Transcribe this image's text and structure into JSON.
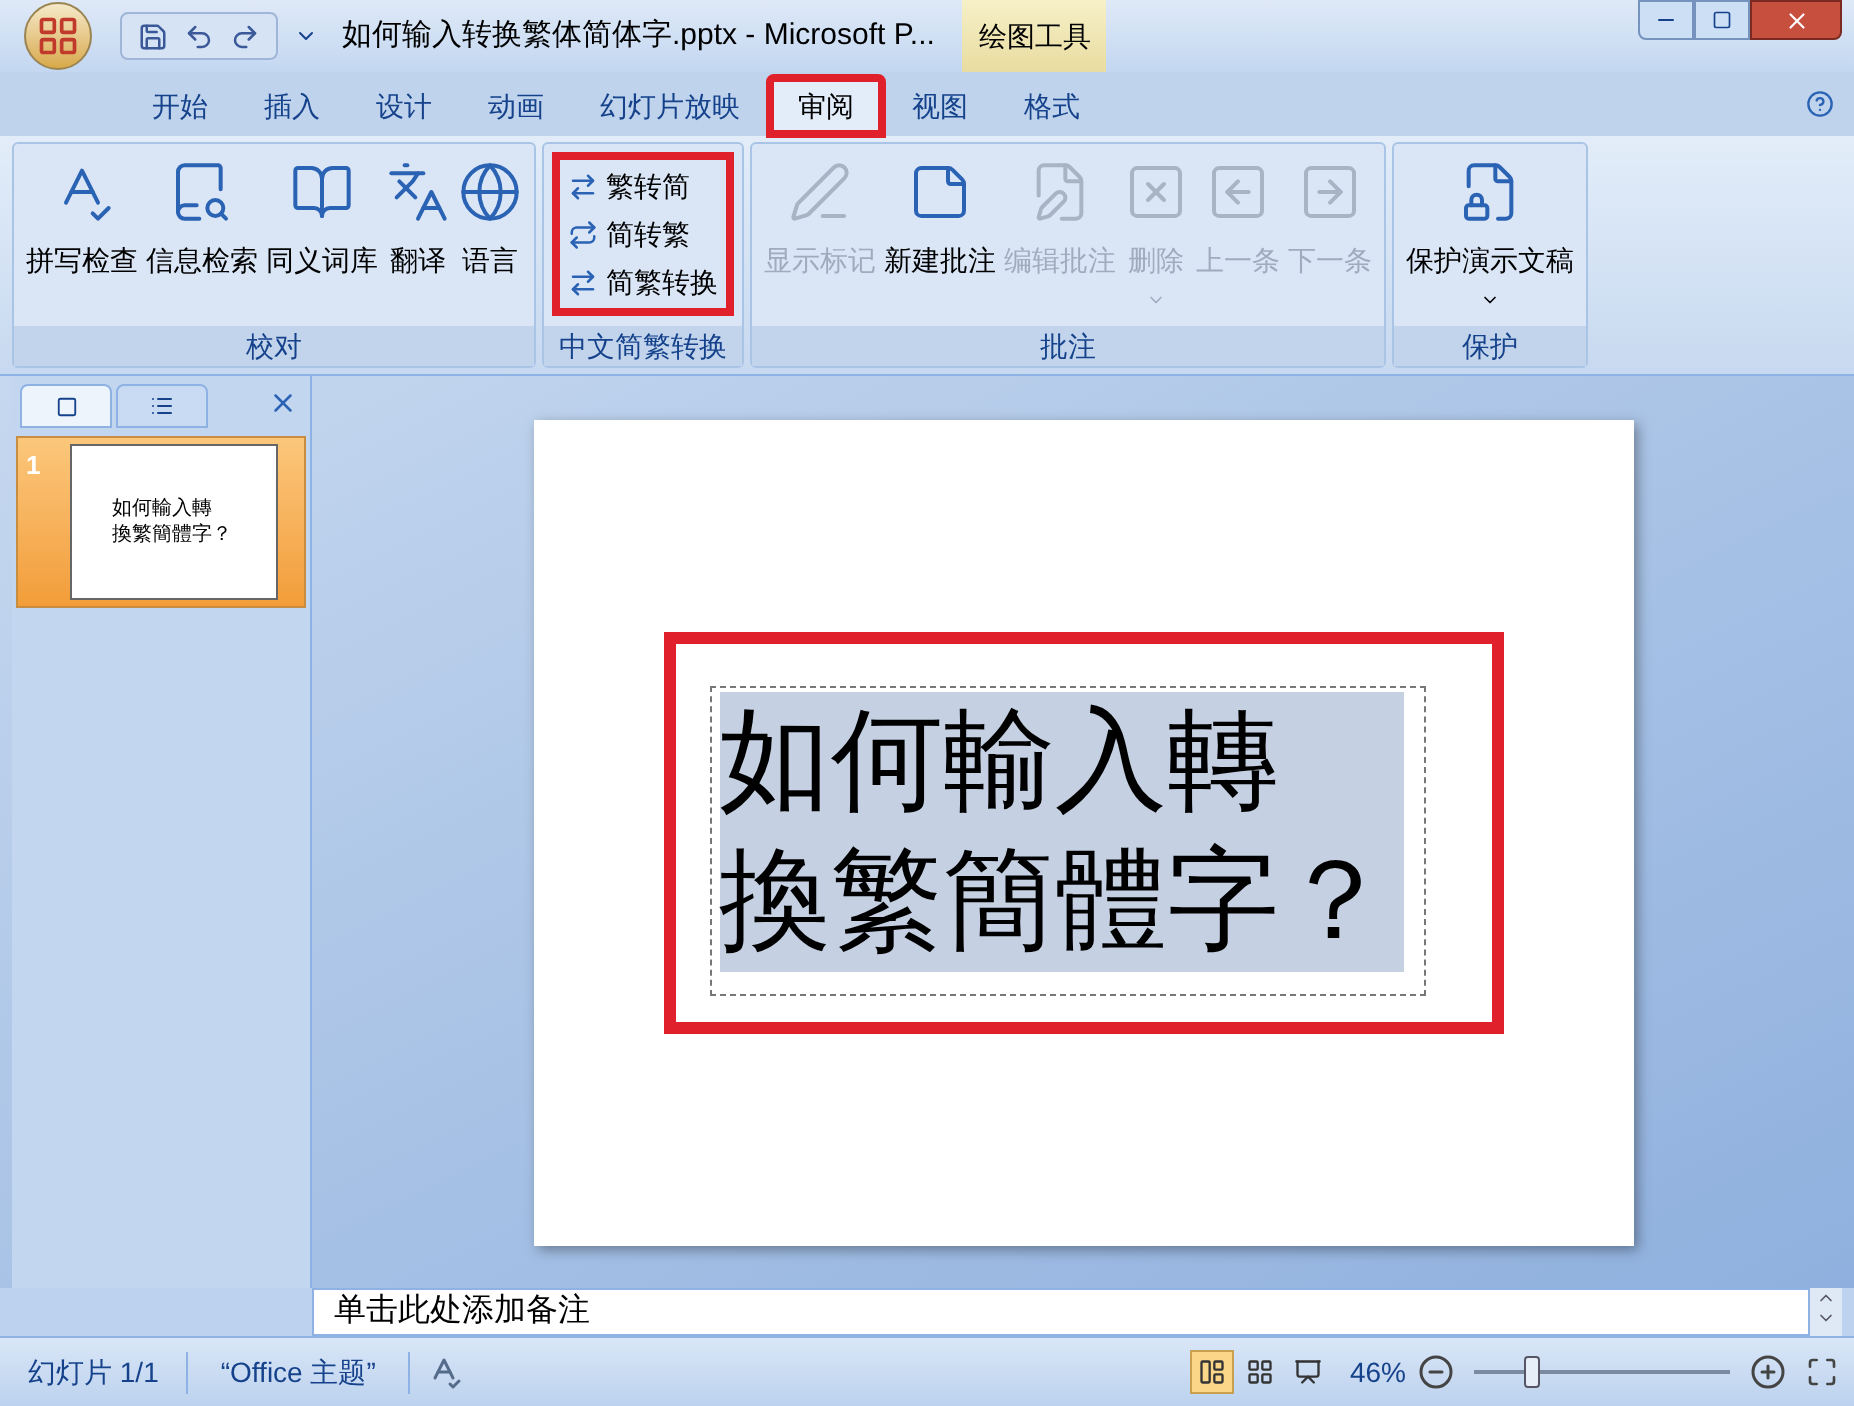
{
  "window": {
    "title": "如何输入转换繁体简体字.pptx - Microsoft P...",
    "contextual_tab": "绘图工具"
  },
  "tabs": [
    {
      "label": "开始",
      "selected": false,
      "highlighted": false
    },
    {
      "label": "插入",
      "selected": false,
      "highlighted": false
    },
    {
      "label": "设计",
      "selected": false,
      "highlighted": false
    },
    {
      "label": "动画",
      "selected": false,
      "highlighted": false
    },
    {
      "label": "幻灯片放映",
      "selected": false,
      "highlighted": false
    },
    {
      "label": "审阅",
      "selected": true,
      "highlighted": true
    },
    {
      "label": "视图",
      "selected": false,
      "highlighted": false
    },
    {
      "label": "格式",
      "selected": false,
      "highlighted": false
    }
  ],
  "ribbon": {
    "groups": [
      {
        "label": "校对",
        "kind": "large",
        "buttons": [
          {
            "label": "拼写检查",
            "disabled": false
          },
          {
            "label": "信息检索",
            "disabled": false
          },
          {
            "label": "同义词库",
            "disabled": false
          },
          {
            "label": "翻译",
            "disabled": false
          },
          {
            "label": "语言",
            "disabled": false
          }
        ]
      },
      {
        "label": "中文简繁转换",
        "highlighted": true,
        "kind": "small",
        "buttons": [
          {
            "label": "繁转简",
            "disabled": false
          },
          {
            "label": "简转繁",
            "disabled": false
          },
          {
            "label": "简繁转换",
            "disabled": false
          }
        ]
      },
      {
        "label": "批注",
        "kind": "large",
        "buttons": [
          {
            "label": "显示标记",
            "disabled": true
          },
          {
            "label": "新建批注",
            "disabled": false
          },
          {
            "label": "编辑批注",
            "disabled": true
          },
          {
            "label": "删除",
            "disabled": true,
            "dropdown": true
          },
          {
            "label": "上一条",
            "disabled": true
          },
          {
            "label": "下一条",
            "disabled": true
          }
        ]
      },
      {
        "label": "保护",
        "kind": "large",
        "buttons": [
          {
            "label": "保护演示文稿",
            "disabled": false,
            "dropdown": true
          }
        ]
      }
    ]
  },
  "slides_panel": {
    "thumbnails": [
      {
        "number": "1",
        "selected": true,
        "lines": [
          "如何輸入轉",
          "換繁簡體字？"
        ]
      }
    ]
  },
  "slide": {
    "text_box": {
      "highlighted": true,
      "selected": true,
      "lines": [
        "如何輸入轉",
        "換繁簡體字？"
      ]
    }
  },
  "notes": {
    "placeholder": "单击此处添加备注"
  },
  "status_bar": {
    "slide": "幻灯片 1/1",
    "theme": "“Office 主题”",
    "zoom": "46%",
    "zoom_slider": {
      "level": 0.23
    },
    "views": [
      {
        "selected": true
      },
      {
        "selected": false
      },
      {
        "selected": false
      }
    ]
  }
}
